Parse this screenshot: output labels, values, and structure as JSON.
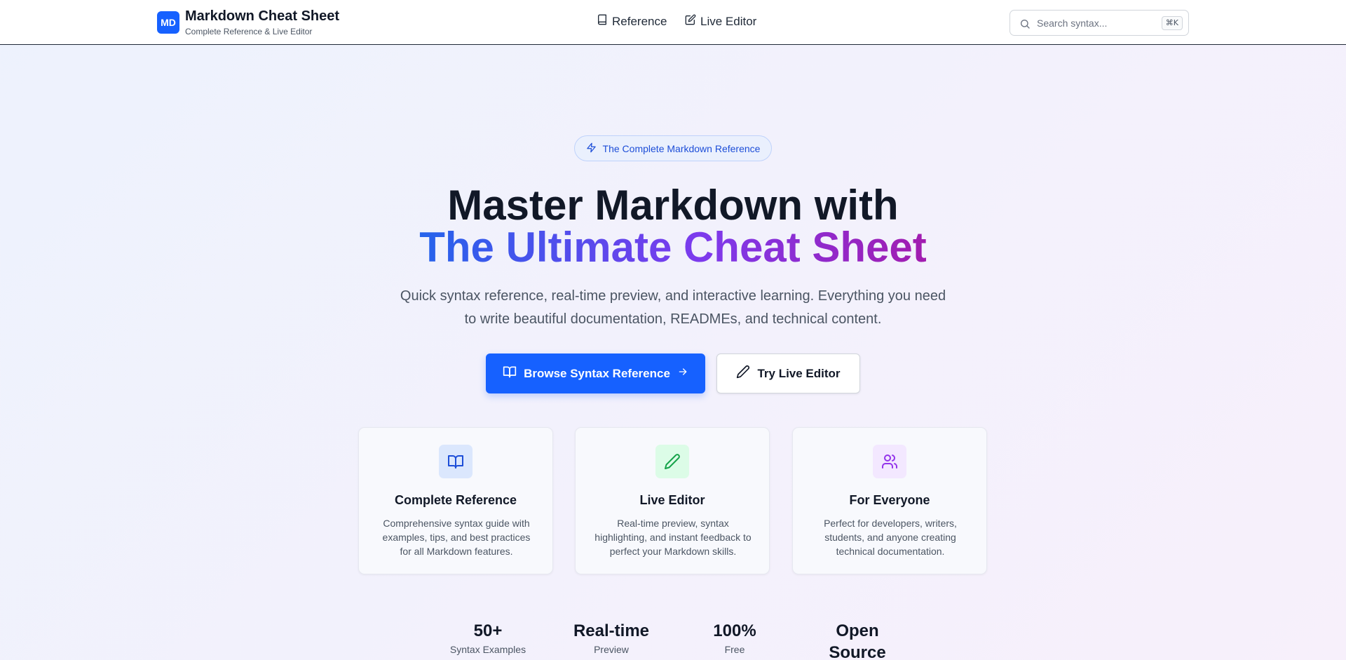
{
  "brand": {
    "logo_text": "MD",
    "title": "Markdown Cheat Sheet",
    "subtitle": "Complete Reference & Live Editor"
  },
  "nav": {
    "items": [
      {
        "label": "Reference",
        "icon": "book-icon"
      },
      {
        "label": "Live Editor",
        "icon": "edit-icon"
      }
    ]
  },
  "search": {
    "placeholder": "Search syntax...",
    "shortcut": "⌘K",
    "icon": "search-icon"
  },
  "hero": {
    "badge": "The Complete Markdown Reference",
    "badge_icon": "lightning-icon",
    "title_line1": "Master Markdown with",
    "title_line2": "The Ultimate Cheat Sheet",
    "description": "Quick syntax reference, real-time preview, and interactive learning. Everything you need to write beautiful documentation, READMEs, and technical content.",
    "primary_button": "Browse Syntax Reference",
    "secondary_button": "Try Live Editor"
  },
  "features": [
    {
      "icon": "book-open-icon",
      "title": "Complete Reference",
      "description": "Comprehensive syntax guide with examples, tips, and best practices for all Markdown features."
    },
    {
      "icon": "pen-icon",
      "title": "Live Editor",
      "description": "Real-time preview, syntax highlighting, and instant feedback to perfect your Markdown skills."
    },
    {
      "icon": "users-icon",
      "title": "For Everyone",
      "description": "Perfect for developers, writers, students, and anyone creating technical documentation."
    }
  ],
  "stats": [
    {
      "value": "50+",
      "label": "Syntax Examples"
    },
    {
      "value": "Real-time",
      "label": "Preview"
    },
    {
      "value": "100%",
      "label": "Free"
    },
    {
      "value": "Open Source",
      "label": ""
    }
  ],
  "colors": {
    "primary": "#1661ff",
    "gradient_start": "#2563eb",
    "gradient_end": "#a21caf"
  }
}
